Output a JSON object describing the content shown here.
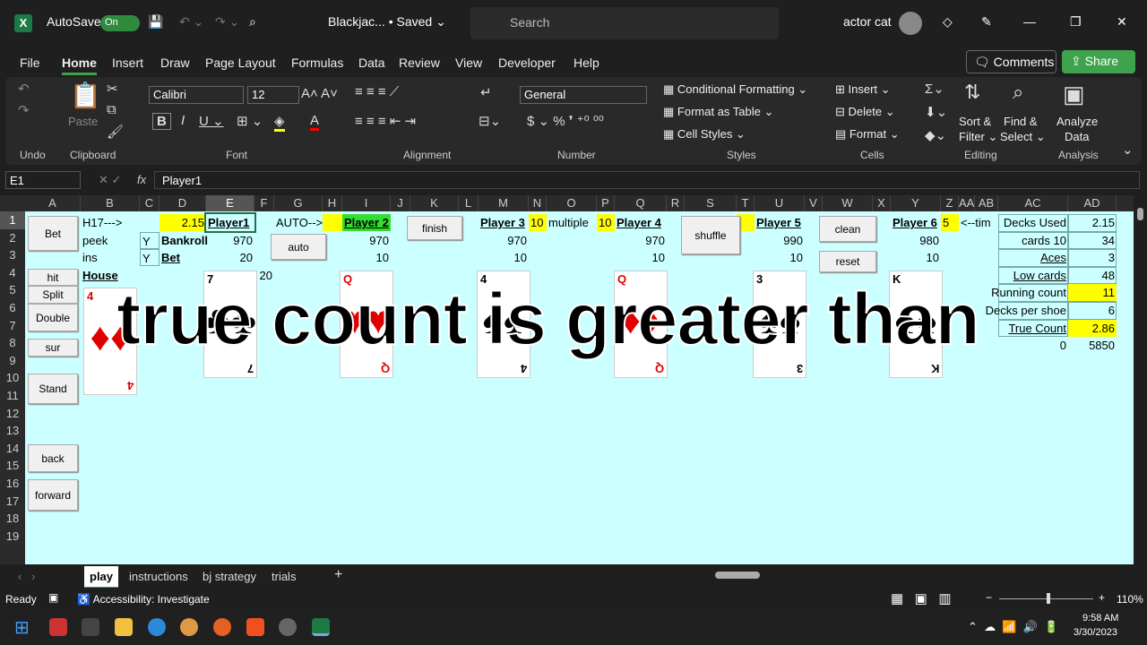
{
  "titlebar": {
    "autosave": "AutoSave",
    "toggle": "On",
    "doc": "Blackjac... • Saved ⌄",
    "search_placeholder": "Search",
    "user": "actor cat",
    "minimize": "—",
    "restore": "❐",
    "close": "✕"
  },
  "menu": {
    "items": [
      "File",
      "Home",
      "Insert",
      "Draw",
      "Page Layout",
      "Formulas",
      "Data",
      "Review",
      "View",
      "Developer",
      "Help"
    ],
    "comments": "Comments",
    "share": "Share"
  },
  "ribbon": {
    "groups": [
      "Undo",
      "Clipboard",
      "Font",
      "Alignment",
      "Number",
      "Styles",
      "Cells",
      "Editing",
      "Analysis"
    ],
    "paste": "Paste",
    "font": "Calibri",
    "size": "12",
    "number_format": "General",
    "conditional": "Conditional Formatting ⌄",
    "format_table": "Format as Table ⌄",
    "cell_styles": "Cell Styles ⌄",
    "insert": "Insert ⌄",
    "delete": "Delete ⌄",
    "format": "Format ⌄",
    "sort": "Sort &",
    "filter": "Filter ⌄",
    "find": "Find &",
    "select": "Select ⌄",
    "analyze": "Analyze",
    "analyze2": "Data"
  },
  "formula": {
    "namebox": "E1",
    "fx": "fx",
    "content": "Player1"
  },
  "columns": [
    "A",
    "B",
    "C",
    "D",
    "E",
    "F",
    "G",
    "H",
    "I",
    "J",
    "K",
    "L",
    "M",
    "N",
    "O",
    "P",
    "Q",
    "R",
    "S",
    "T",
    "U",
    "V",
    "W",
    "X",
    "Y",
    "Z",
    "AA",
    "AB",
    "AC",
    "AD"
  ],
  "rows": [
    "1",
    "2",
    "3",
    "4",
    "5",
    "6",
    "7",
    "8",
    "9",
    "10",
    "11",
    "12",
    "13",
    "14",
    "15",
    "16",
    "17",
    "18",
    "19"
  ],
  "cells": [
    {
      "ref": "B1",
      "v": "H17--->"
    },
    {
      "ref": "D1",
      "v": "2.15",
      "align": "right",
      "bg": "#ffff00"
    },
    {
      "ref": "E1",
      "v": "Player1",
      "bold": true,
      "u": true
    },
    {
      "ref": "G1",
      "v": "AUTO-->"
    },
    {
      "ref": "H1",
      "v": "",
      "bg": "#ffff00"
    },
    {
      "ref": "I1",
      "v": "Player 2",
      "bold": true,
      "u": true,
      "bg": "#33dd33"
    },
    {
      "ref": "M1",
      "v": "Player 3",
      "bold": true,
      "u": true
    },
    {
      "ref": "N1",
      "v": "10",
      "bg": "#ffff00"
    },
    {
      "ref": "O1",
      "v": "multiple"
    },
    {
      "ref": "P1",
      "v": "10",
      "bg": "#ffff00"
    },
    {
      "ref": "Q1",
      "v": "Player 4",
      "bold": true,
      "u": true
    },
    {
      "ref": "T1",
      "v": "",
      "bg": "#ffff00"
    },
    {
      "ref": "U1",
      "v": "Player 5",
      "bold": true,
      "u": true
    },
    {
      "ref": "Y1",
      "v": "Player 6",
      "bold": true,
      "u": true
    },
    {
      "ref": "Z1",
      "v": "5",
      "bg": "#ffff00"
    },
    {
      "ref": "AA1",
      "v": "<--tim"
    },
    {
      "ref": "B2",
      "v": "peek"
    },
    {
      "ref": "C2",
      "v": "Y"
    },
    {
      "ref": "D2",
      "v": "Bankroll",
      "bold": true
    },
    {
      "ref": "E2",
      "v": "970",
      "align": "right"
    },
    {
      "ref": "I2",
      "v": "970",
      "align": "right"
    },
    {
      "ref": "M2",
      "v": "970",
      "align": "right"
    },
    {
      "ref": "Q2",
      "v": "970",
      "align": "right"
    },
    {
      "ref": "U2",
      "v": "990",
      "align": "right"
    },
    {
      "ref": "Y2",
      "v": "980",
      "align": "right"
    },
    {
      "ref": "B3",
      "v": "ins"
    },
    {
      "ref": "C3",
      "v": "Y"
    },
    {
      "ref": "D3",
      "v": "Bet",
      "bold": true,
      "u": true
    },
    {
      "ref": "E3",
      "v": "20",
      "align": "right"
    },
    {
      "ref": "I3",
      "v": "10",
      "align": "right"
    },
    {
      "ref": "M3",
      "v": "10",
      "align": "right"
    },
    {
      "ref": "Q3",
      "v": "10",
      "align": "right"
    },
    {
      "ref": "U3",
      "v": "10",
      "align": "right"
    },
    {
      "ref": "Y3",
      "v": "10",
      "align": "right"
    },
    {
      "ref": "B4",
      "v": "House",
      "bold": true,
      "u": true
    },
    {
      "ref": "F4",
      "v": "20",
      "align": "right"
    },
    {
      "ref": "AC1",
      "v": "Decks Used",
      "align": "right"
    },
    {
      "ref": "AD1",
      "v": "2.15",
      "align": "right"
    },
    {
      "ref": "AC2",
      "v": "10 cards",
      "align": "right"
    },
    {
      "ref": "AD2",
      "v": "34",
      "align": "right"
    },
    {
      "ref": "AC3",
      "v": "Aces",
      "align": "right",
      "u": true
    },
    {
      "ref": "AD3",
      "v": "3",
      "align": "right"
    },
    {
      "ref": "AC4",
      "v": "Low cards",
      "align": "right",
      "u": true
    },
    {
      "ref": "AD4",
      "v": "48",
      "align": "right"
    },
    {
      "ref": "AC5",
      "v": "Running count",
      "align": "right"
    },
    {
      "ref": "AD5",
      "v": "11",
      "align": "right",
      "bg": "#ffff00"
    },
    {
      "ref": "AC6",
      "v": "Decks per shoe",
      "align": "right"
    },
    {
      "ref": "AD6",
      "v": "6",
      "align": "right"
    },
    {
      "ref": "AC7",
      "v": "True Count",
      "align": "right",
      "u": true
    },
    {
      "ref": "AD7",
      "v": "2.86",
      "align": "right",
      "bg": "#ffff00"
    },
    {
      "ref": "AC8",
      "v": "0",
      "align": "right"
    },
    {
      "ref": "AD8",
      "v": "5850",
      "align": "right"
    }
  ],
  "buttons": [
    {
      "label": "Bet",
      "col": "A",
      "row": 1,
      "h": 2
    },
    {
      "label": "hit",
      "col": "A",
      "row": 4,
      "h": 1
    },
    {
      "label": "Split",
      "col": "A",
      "row": 5,
      "h": 1
    },
    {
      "label": "Double",
      "col": "A",
      "row": 6,
      "h": 1.6
    },
    {
      "label": "sur",
      "col": "A",
      "row": 8,
      "h": 1
    },
    {
      "label": "Stand",
      "col": "A",
      "row": 10,
      "h": 1.7
    },
    {
      "label": "back",
      "col": "A",
      "row": 14,
      "h": 1.6
    },
    {
      "label": "forward",
      "col": "A",
      "row": 16,
      "h": 1.8
    },
    {
      "label": "auto",
      "col": "G",
      "row": 2,
      "h": 1.5
    },
    {
      "label": "finish",
      "col": "K",
      "row": 1,
      "h": 1.4
    },
    {
      "label": "shuffle",
      "col": "S",
      "row": 1,
      "h": 2.2
    },
    {
      "label": "clean",
      "col": "W",
      "row": 1,
      "h": 1.5
    },
    {
      "label": "reset",
      "col": "W",
      "row": 3,
      "h": 1.2
    }
  ],
  "cards": [
    {
      "col": "B",
      "row": 5,
      "rank": "4",
      "suit": "♦",
      "color": "#e00000"
    },
    {
      "col": "E",
      "row": 4,
      "rank": "7",
      "suit": "♣",
      "color": "#000000"
    },
    {
      "col": "I",
      "row": 4,
      "rank": "Q",
      "suit": "♥",
      "color": "#e00000"
    },
    {
      "col": "M",
      "row": 4,
      "rank": "4",
      "suit": "♠",
      "color": "#000000"
    },
    {
      "col": "Q",
      "row": 4,
      "rank": "Q",
      "suit": "♦",
      "color": "#e00000"
    },
    {
      "col": "U",
      "row": 4,
      "rank": "3",
      "suit": "♠",
      "color": "#000000"
    },
    {
      "col": "Y",
      "row": 4,
      "rank": "K",
      "suit": "♠",
      "color": "#000000"
    }
  ],
  "caption": "true count is greater than",
  "sheets": {
    "tabs": [
      "play",
      "instructions",
      "bj strategy",
      "trials"
    ],
    "active": "play",
    "add": "+"
  },
  "status": {
    "ready": "Ready",
    "accessibility": "Accessibility: Investigate",
    "zoom": "110%"
  },
  "taskbar": {
    "time": "9:58 AM",
    "date": "3/30/2023"
  },
  "colors": {
    "sheet_bg": "#ccffff",
    "highlight": "#ffff00",
    "green": "#33dd33",
    "accent": "#3fa34d"
  }
}
